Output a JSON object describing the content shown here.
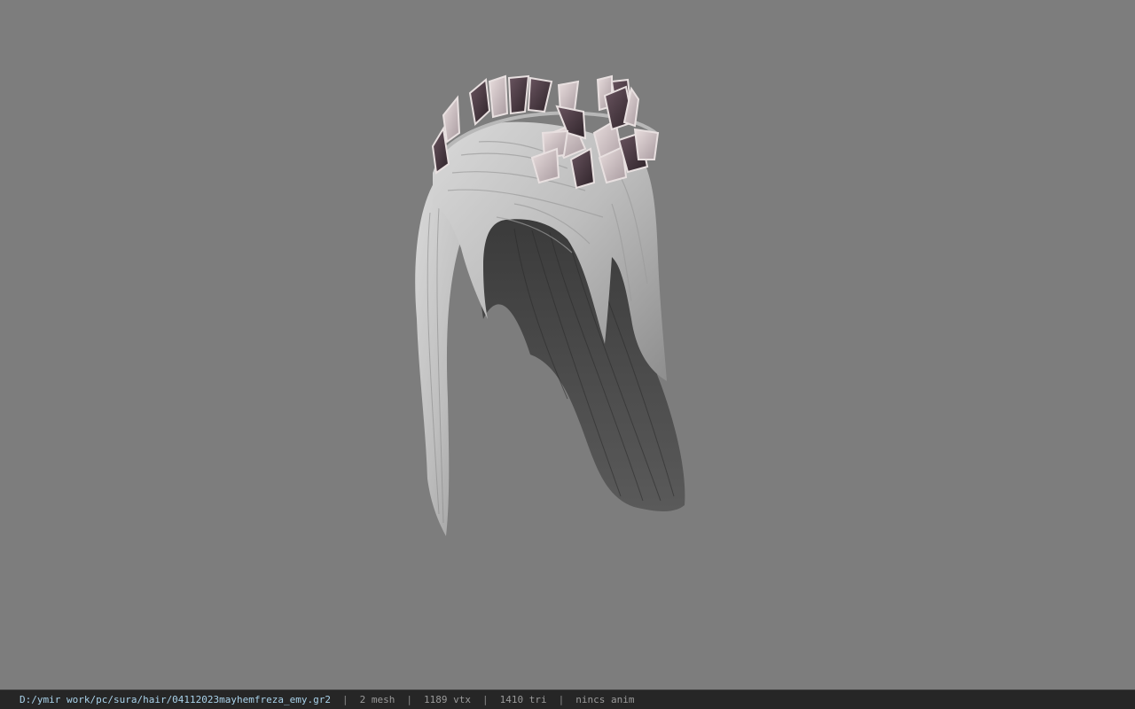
{
  "viewport": {
    "background_color": "#7d7d7d",
    "model": "hair-with-leaf-crown"
  },
  "status_bar": {
    "file_path": "D:/ymir work/pc/sura/hair/04112023mayhemfreza_emy.gr2",
    "separator": "|",
    "mesh_count": "2 mesh",
    "vertex_count": "1189 vtx",
    "triangle_count": "1410 tri",
    "animation": "nincs anim"
  },
  "colors": {
    "status_bg": "#262626",
    "path_text": "#a9d2ea",
    "stat_text": "#9a9a9a"
  }
}
